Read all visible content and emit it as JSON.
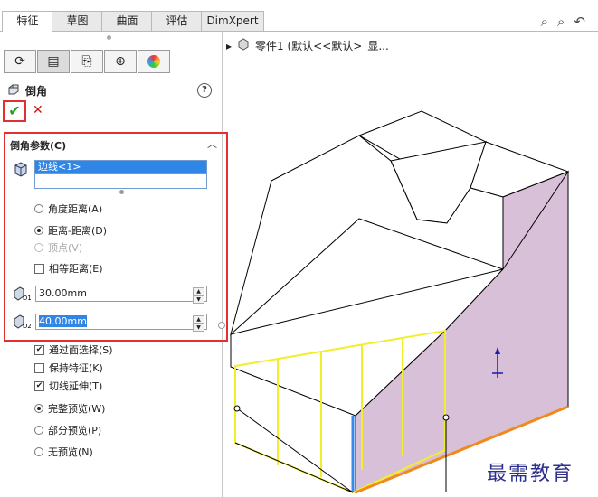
{
  "tabs": [
    {
      "label": "特征",
      "active": true
    },
    {
      "label": "草图",
      "active": false
    },
    {
      "label": "曲面",
      "active": false
    },
    {
      "label": "评估",
      "active": false
    },
    {
      "label": "DimXpert",
      "active": false
    }
  ],
  "feature": {
    "title": "倒角",
    "help_icon": "help-icon",
    "ok_icon": "check-icon",
    "cancel_icon": "close-icon"
  },
  "group": {
    "title": "倒角参数(C)",
    "edge_list": [
      "边线<1>"
    ],
    "options_radio": [
      {
        "label": "角度距离(A)",
        "selected": false,
        "enabled": true
      },
      {
        "label": "距离-距离(D)",
        "selected": true,
        "enabled": true
      },
      {
        "label": "顶点(V)",
        "selected": false,
        "enabled": false
      }
    ],
    "equal_distance": {
      "label": "相等距离(E)",
      "checked": false
    },
    "d1": {
      "value": "30.00mm",
      "icon_label": "D1"
    },
    "d2": {
      "value": "40.00mm",
      "icon_label": "D2"
    }
  },
  "lower_options": {
    "checkboxes": [
      {
        "label": "通过面选择(S)",
        "checked": true
      },
      {
        "label": "保持特征(K)",
        "checked": false
      },
      {
        "label": "切线延伸(T)",
        "checked": true
      }
    ],
    "radios": [
      {
        "label": "完整预览(W)",
        "selected": true
      },
      {
        "label": "部分预览(P)",
        "selected": false
      },
      {
        "label": "无预览(N)",
        "selected": false
      }
    ]
  },
  "tree": {
    "label": "零件1  (默认<<默认>_显..."
  },
  "watermark": "最需教育",
  "colors": {
    "accent_red": "#e03030",
    "selection_blue": "#2f86e6",
    "preview_yellow": "#f4ee2a",
    "face_purple": "#d9c0d9",
    "edge_orange": "#f08a1c"
  }
}
